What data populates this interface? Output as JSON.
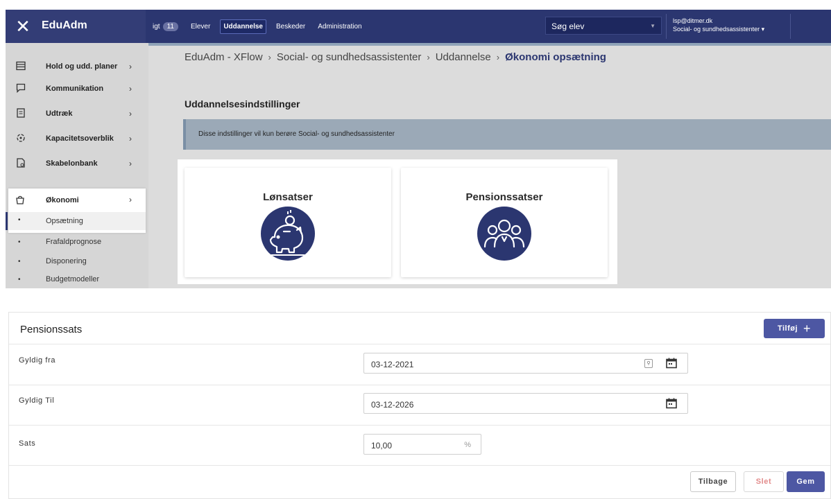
{
  "app": {
    "brand": "EduAdm",
    "close_glyph": "✕"
  },
  "topnav": {
    "items": [
      {
        "label": "igt",
        "badge": "11"
      },
      {
        "label": "Elever"
      },
      {
        "label": "Uddannelse",
        "active": true
      },
      {
        "label": "Beskeder"
      },
      {
        "label": "Administration"
      }
    ],
    "search_label": "Søg elev",
    "user_email": "lsp@ditmer.dk",
    "user_org": "Social- og sundhedsassistenter ▾"
  },
  "sidebar": {
    "items": [
      {
        "label": "Hold og udd. planer",
        "icon": "table-icon"
      },
      {
        "label": "Kommunikation",
        "icon": "chat-icon"
      },
      {
        "label": "Udtræk",
        "icon": "export-icon"
      },
      {
        "label": "Kapacitetsoverblik",
        "icon": "capacity-icon"
      },
      {
        "label": "Skabelonbank",
        "icon": "template-icon"
      },
      {
        "label": "Økonomi",
        "icon": "bag-icon"
      }
    ],
    "subitems": [
      "Opsætning",
      "Frafaldprognose",
      "Disponering",
      "Budgetmodeller"
    ],
    "chevron": "›",
    "dot": "•"
  },
  "breadcrumb": {
    "parts": [
      "EduAdm - XFlow",
      "Social- og sundhedsassistenter",
      "Uddannelse",
      "Økonomi opsætning"
    ],
    "sep": "›"
  },
  "settings": {
    "title": "Uddannelsesindstillinger",
    "info": "Disse indstillinger vil kun berøre Social- og sundhedsassistenter",
    "cards": [
      {
        "title": "Lønsatser",
        "icon": "piggy-bank-icon"
      },
      {
        "title": "Pensionssatser",
        "icon": "people-group-icon"
      }
    ]
  },
  "form": {
    "title": "Pensionssats",
    "add_label": "Tilføj",
    "add_plus": "+",
    "fields": {
      "from_label": "Gyldig fra",
      "from_value": "03-12-2021",
      "to_label": "Gyldig Til",
      "to_value": "03-12-2026",
      "rate_label": "Sats",
      "rate_value": "10,00",
      "rate_unit": "%"
    },
    "buttons": {
      "back": "Tilbage",
      "delete": "Slet",
      "save": "Gem"
    }
  },
  "colors": {
    "primary": "#2b3670",
    "button": "#4d57a3",
    "danger_text": "#e28a8a"
  }
}
